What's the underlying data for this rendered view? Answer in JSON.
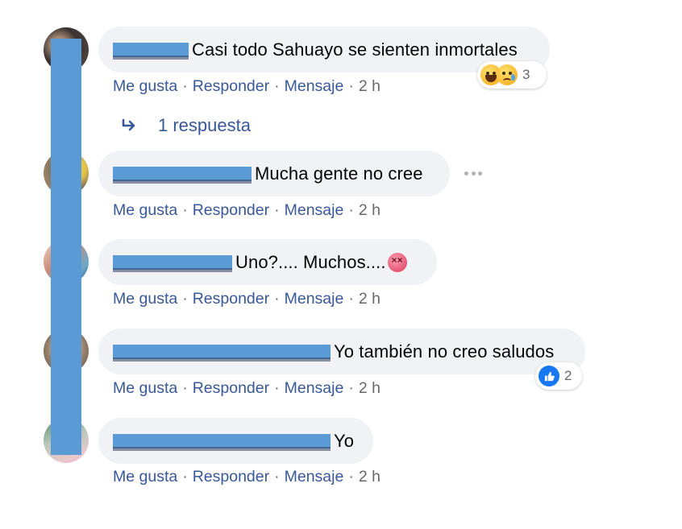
{
  "reply_link_label": "1 respuesta",
  "actions": {
    "like": "Me gusta",
    "reply": "Responder",
    "message": "Mensaje",
    "separator": "·"
  },
  "comments": [
    {
      "text": "Casi todo Sahuayo se sienten inmortales",
      "time": "2 h",
      "reactions": {
        "icons": [
          "haha-icon",
          "sad-icon"
        ],
        "count": "3"
      }
    },
    {
      "text": "Mucha gente no cree",
      "time": "2 h"
    },
    {
      "text": "Uno?.... Muchos....",
      "emoji": "dizzy-face-icon",
      "time": "2 h"
    },
    {
      "text": "Yo también no creo saludos",
      "time": "2 h",
      "reactions": {
        "icons": [
          "like-icon"
        ],
        "count": "2"
      }
    },
    {
      "text": "Yo",
      "time": "2 h"
    }
  ],
  "colors": {
    "link": "#385898",
    "muted": "#65676b",
    "bubble": "#f0f2f5",
    "redaction": "#5b9bd5",
    "like_blue": "#1877f2"
  }
}
